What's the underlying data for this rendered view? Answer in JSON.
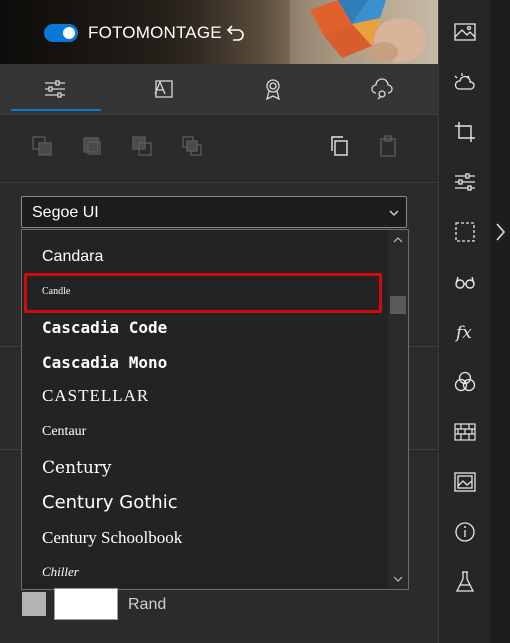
{
  "header": {
    "toggle_on": true,
    "title": "FOTOMONTAGE"
  },
  "tabs": [
    {
      "name": "adjust-sliders-icon",
      "active": true
    },
    {
      "name": "text-icon",
      "active": false
    },
    {
      "name": "badge-icon",
      "active": false
    },
    {
      "name": "cloud-settings-icon",
      "active": false
    }
  ],
  "font_select": {
    "value": "Segoe UI"
  },
  "font_list": {
    "items": [
      "Candara",
      "Candle",
      "Cascadia Code",
      "Cascadia Mono",
      "CASTELLAR",
      "Centaur",
      "Century",
      "Century Gothic",
      "Century Schoolbook",
      "Chiller"
    ],
    "highlighted": "Candle"
  },
  "colors": {
    "accent": "#0a78d7",
    "highlight": "#d10b0b",
    "swatch_grey": "#b3b3b3",
    "swatch_white": "#ffffff"
  },
  "color_row": {
    "label": "Rand"
  },
  "sidebar": {
    "icons": [
      "image-landscape-icon",
      "weather-icon",
      "crop-icon",
      "sliders-icon",
      "selection-icon",
      "glasses-icon",
      "fx-icon",
      "color-circles-icon",
      "brick-texture-icon",
      "picture-frame-icon",
      "info-icon",
      "flask-icon"
    ]
  }
}
